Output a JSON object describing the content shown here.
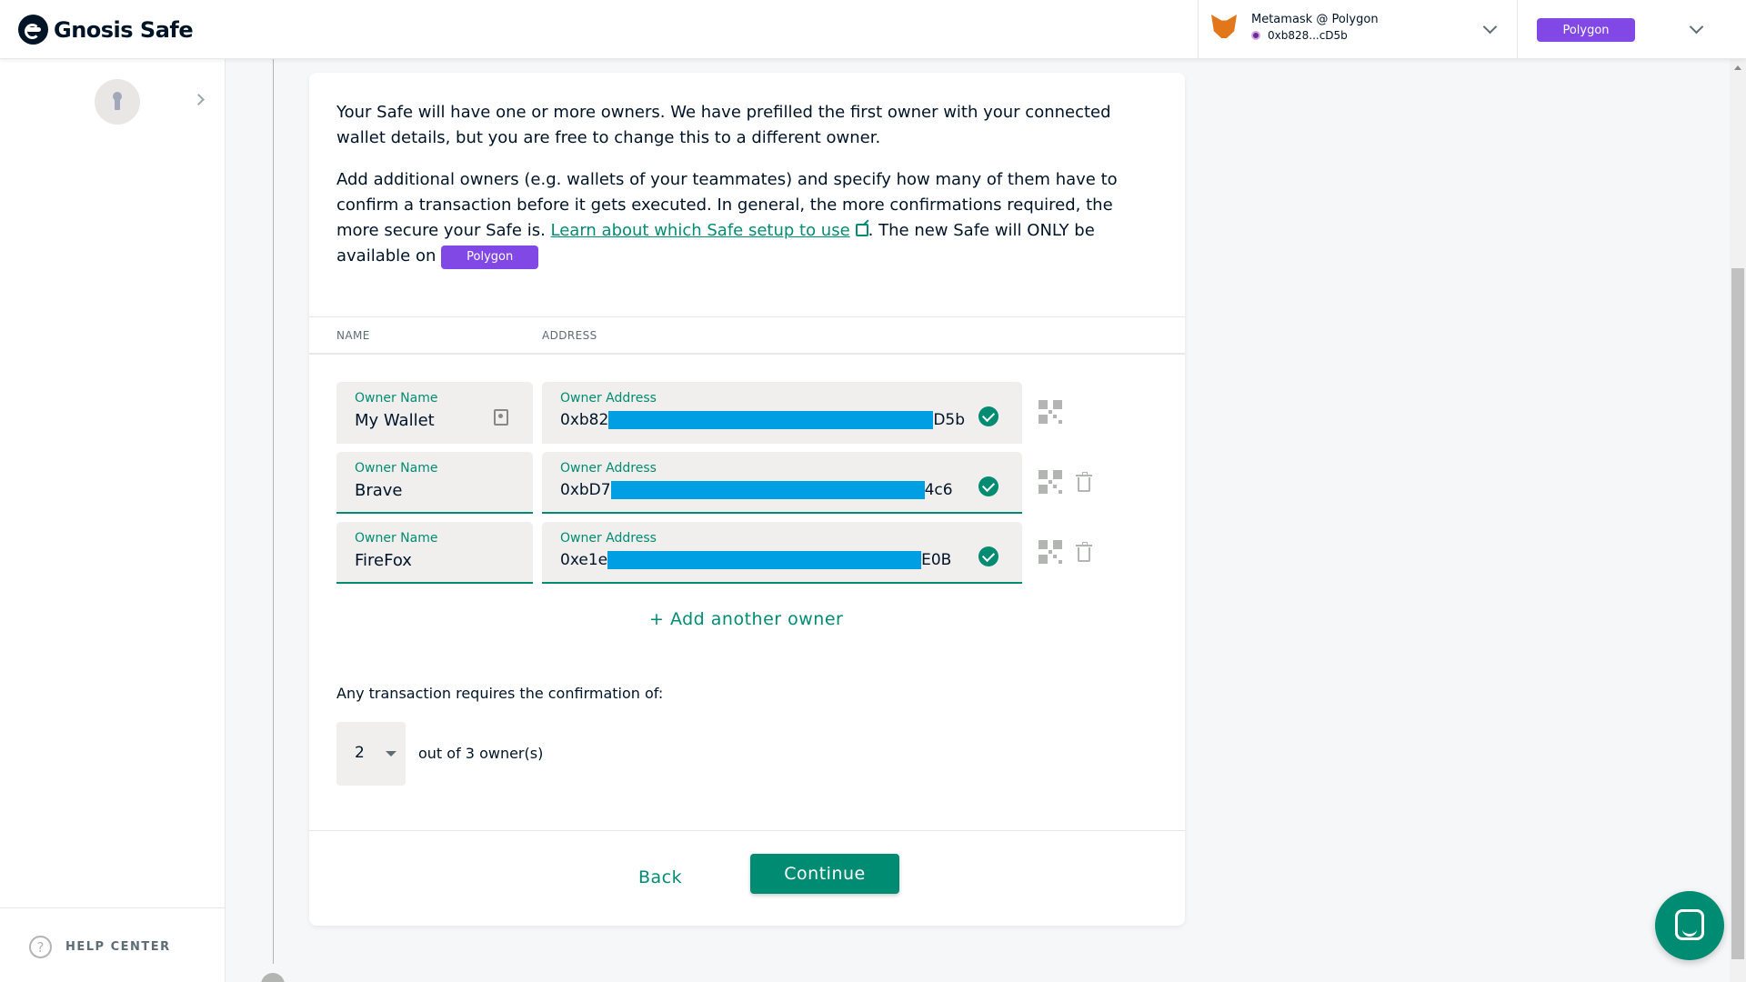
{
  "header": {
    "logo_text": "Gnosis Safe",
    "wallet_name": "Metamask @ Polygon",
    "wallet_address": "0xb828...cD5b",
    "network_badge": "Polygon"
  },
  "sidebar": {
    "help_center": "HELP CENTER"
  },
  "intro": {
    "p1": "Your Safe will have one or more owners. We have prefilled the first owner with your connected wallet details, but you are free to change this to a different owner.",
    "p2_before": "Add additional owners (e.g. wallets of your teammates) and specify how many of them have to confirm a transaction before it gets executed. In general, the more confirmations required, the more secure your Safe is. ",
    "p2_link": "Learn about which Safe setup to use",
    "p2_after": ". The new Safe will ONLY be available on ",
    "network_chip": "Polygon"
  },
  "table": {
    "col_name": "NAME",
    "col_address": "ADDRESS"
  },
  "owners": [
    {
      "name_label": "Owner Name",
      "name": "My Wallet",
      "addr_label": "Owner Address",
      "addr_start": "0xb82",
      "addr_end": "D5b"
    },
    {
      "name_label": "Owner Name",
      "name": "Brave",
      "addr_label": "Owner Address",
      "addr_start": "0xbD7",
      "addr_end": "4c6"
    },
    {
      "name_label": "Owner Name",
      "name": "FireFox",
      "addr_label": "Owner Address",
      "addr_start": "0xe1e",
      "addr_end": "E0B"
    }
  ],
  "add_owner": "+ Add another owner",
  "threshold": {
    "label": "Any transaction requires the confirmation of:",
    "value": "2",
    "suffix": "out of 3 owner(s)"
  },
  "footer": {
    "back": "Back",
    "continue": "Continue"
  },
  "colors": {
    "accent": "#008c73",
    "network": "#8248e5",
    "redaction": "#009fe3"
  }
}
